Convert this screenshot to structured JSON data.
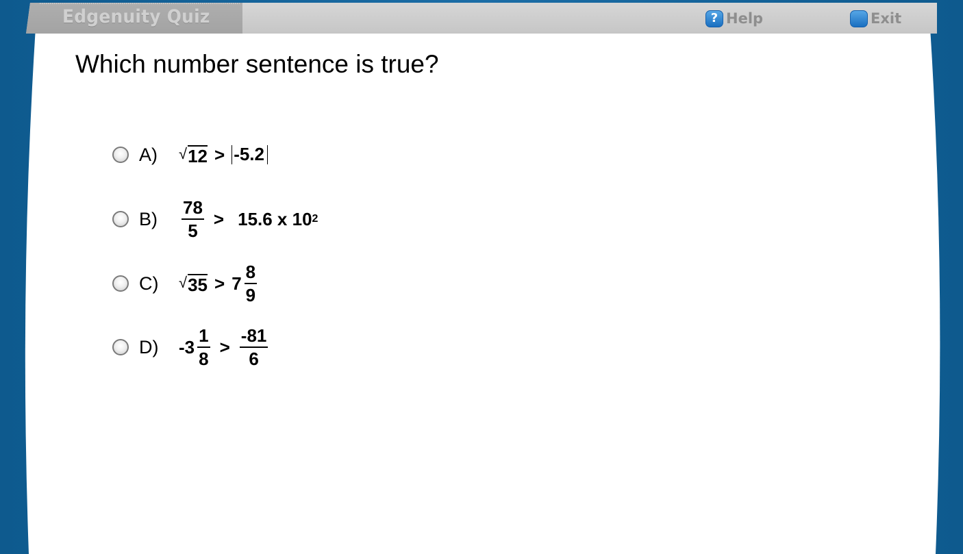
{
  "window": {
    "title": "Edgenuity Quiz",
    "help_label": "Help",
    "help_icon": "question-mark-icon",
    "exit_label": "Exit",
    "exit_icon": "exit-icon",
    "accent_color": "#1b6da6"
  },
  "question": {
    "text": "Which number sentence is true?"
  },
  "options": [
    {
      "label": "A)",
      "parts": {
        "rad": "12",
        "op": ">",
        "abs": "-5.2"
      }
    },
    {
      "label": "B)",
      "parts": {
        "num": "78",
        "den": "5",
        "op": ">",
        "base": "15.6 x 10",
        "exp": "2"
      }
    },
    {
      "label": "C)",
      "parts": {
        "rad": "35",
        "op": ">",
        "whole": "7",
        "num": "8",
        "den": "9"
      }
    },
    {
      "label": "D)",
      "parts": {
        "whole": "-3",
        "num": "1",
        "den": "8",
        "op": ">",
        "num2": "-81",
        "den2": "6"
      }
    }
  ]
}
